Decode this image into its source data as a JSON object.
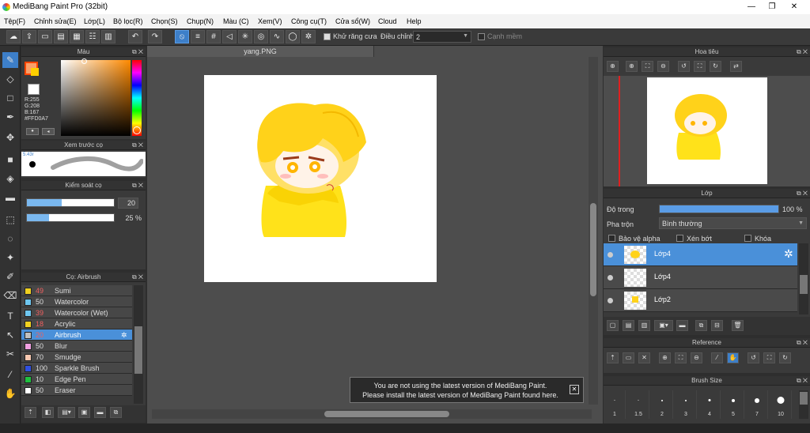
{
  "window": {
    "title": "MediBang Paint Pro (32bit)",
    "min": "—",
    "restore": "❐",
    "close": "✕"
  },
  "menu": [
    "Tệp(F)",
    "Chỉnh sửa(E)",
    "Lớp(L)",
    "Bộ lọc(R)",
    "Chọn(S)",
    "Chụp(N)",
    "Màu (C)",
    "Xem(V)",
    "Công cụ(T)",
    "Cửa sổ(W)",
    "Cloud",
    "Help"
  ],
  "toolbar": {
    "antialias_label": "Khử răng cưa",
    "adjust_label": "Điều chỉnh",
    "adjust_value": "2",
    "edge_label": "Cạnh mềm"
  },
  "color_panel": {
    "title": "Màu",
    "rgb": "R:255\nG:208\nB:167\n#FFD0A7",
    "primary": "#f8a06a",
    "secondary": "#ffffff"
  },
  "brush_preview": {
    "title": "Xem trước cọ",
    "size_label": "5.43r"
  },
  "brush_control": {
    "title": "Kiểm soát cọ",
    "size_value": "20",
    "opacity_value": "25 %",
    "size_fraction": 0.4,
    "opacity_fraction": 0.25
  },
  "brush_list": {
    "title": "Cọ: Airbrush",
    "items": [
      {
        "size": "49",
        "name": "Sumi",
        "color": "#f0d020"
      },
      {
        "size": "50",
        "name": "Watercolor",
        "color": "#6ec6f0"
      },
      {
        "size": "39",
        "name": "Watercolor (Wet)",
        "color": "#6ec6f0"
      },
      {
        "size": "18",
        "name": "Acrylic",
        "color": "#f0d020"
      },
      {
        "size": "20",
        "name": "Airbrush",
        "color": "#c0c0c0"
      },
      {
        "size": "50",
        "name": "Blur",
        "color": "#f0a0e0"
      },
      {
        "size": "70",
        "name": "Smudge",
        "color": "#f8c8b0"
      },
      {
        "size": "100",
        "name": "Sparkle Brush",
        "color": "#3050e0"
      },
      {
        "size": "10",
        "name": "Edge Pen",
        "color": "#20c040"
      },
      {
        "size": "50",
        "name": "Eraser",
        "color": "#ffffff"
      }
    ]
  },
  "document": {
    "tab": "yang.PNG"
  },
  "notice": {
    "line1": "You are not using the latest version of MediBang Paint.",
    "line2": "Please install the latest version of MediBang Paint found here.",
    "close": "✕"
  },
  "navigator": {
    "title": "Hoa tiêu"
  },
  "layers": {
    "title": "Lớp",
    "opacity_label": "Độ trong",
    "opacity_value": "100 %",
    "opacity_fraction": 1.0,
    "blend_label": "Pha trộn",
    "blend_value": "Bình thường",
    "protect_alpha": "Bảo vệ alpha",
    "clip": "Xén bớt",
    "lock": "Khóa",
    "items": [
      {
        "name": "Lớp4"
      },
      {
        "name": "Lớp4"
      },
      {
        "name": "Lớp2"
      }
    ]
  },
  "reference": {
    "title": "Reference"
  },
  "brush_size": {
    "title": "Brush Size",
    "sizes": [
      "1",
      "1.5",
      "2",
      "3",
      "4",
      "5",
      "7",
      "10"
    ]
  },
  "icons": {
    "pen": "✎",
    "eraser": "◇",
    "rect": "□",
    "move": "✥",
    "bucket": "⬛",
    "text": "T",
    "hand": "✋",
    "gear": "✲"
  }
}
